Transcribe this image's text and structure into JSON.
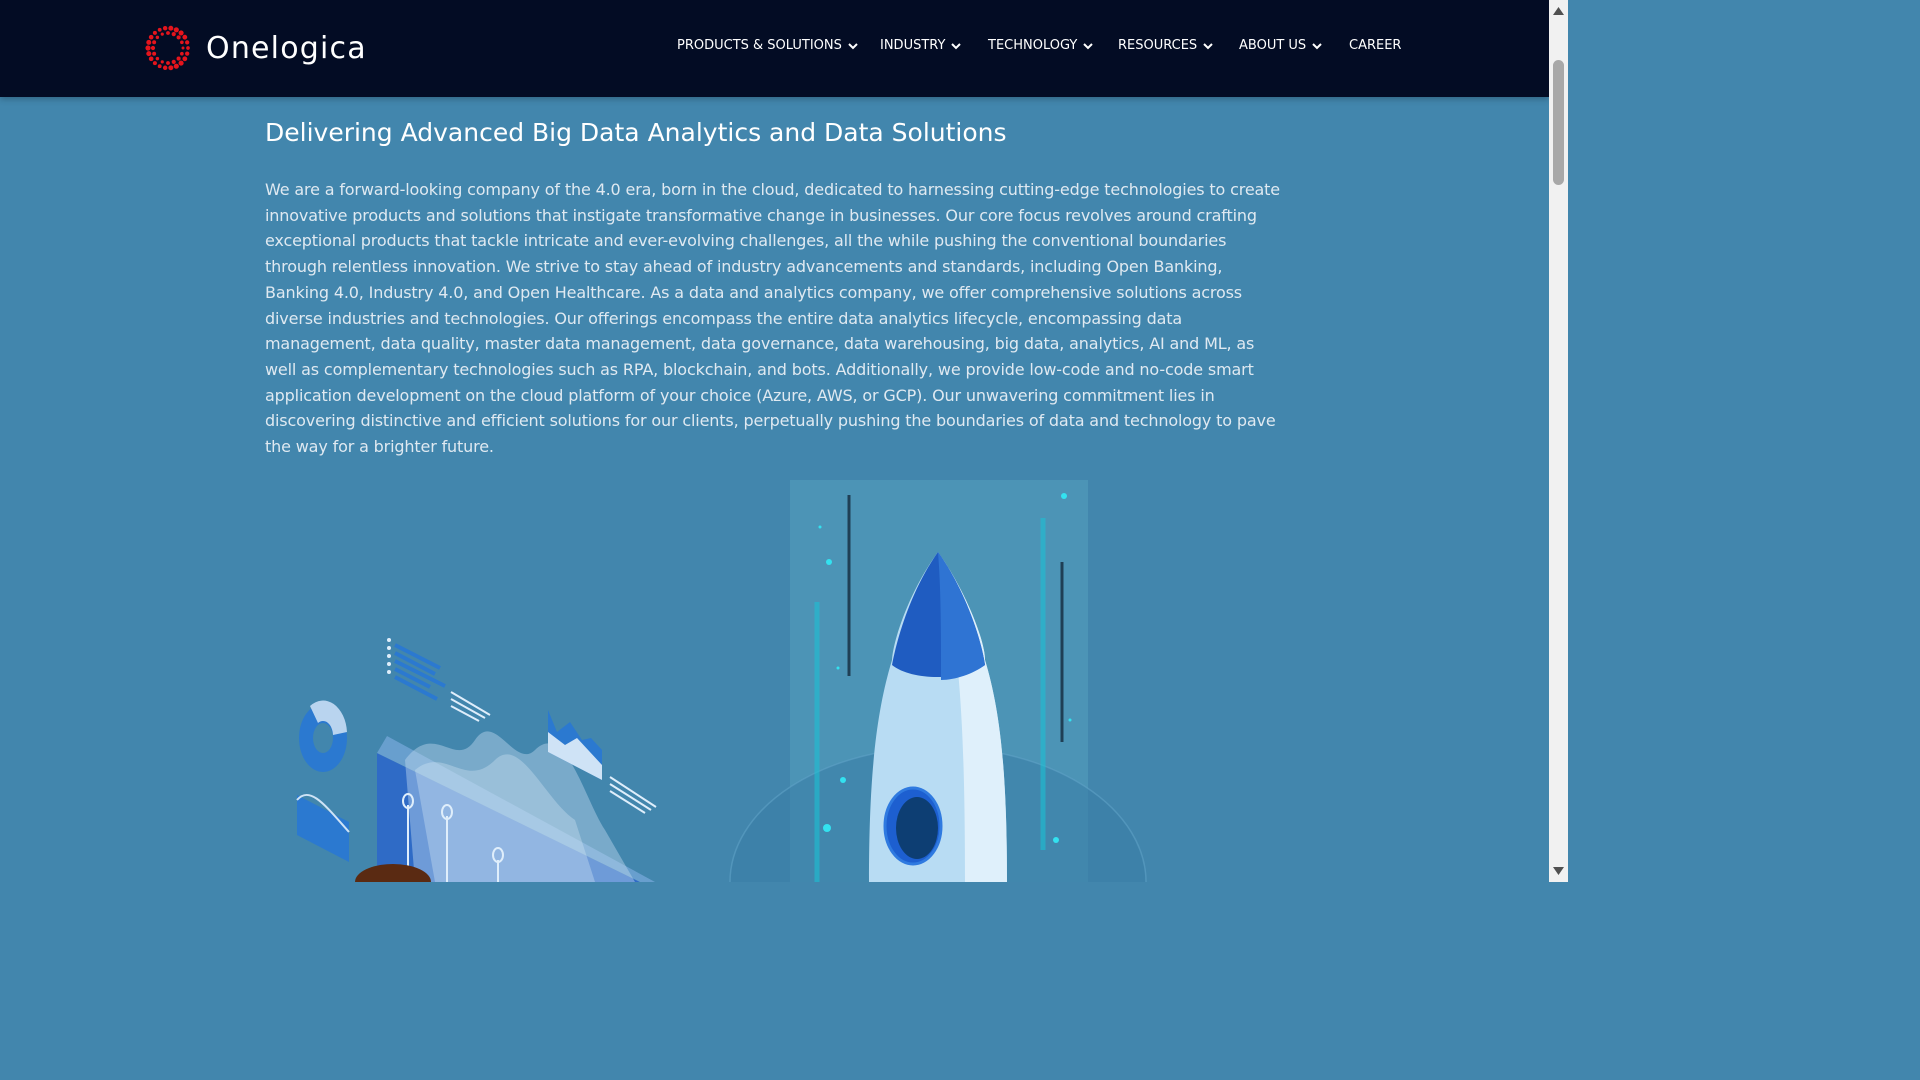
{
  "brand": {
    "name": "Onelogica",
    "logo_icon": "red-dotted-ring-logo",
    "accent": "#e5141c"
  },
  "nav": {
    "items": [
      {
        "label": "PRODUCTS & SOLUTIONS",
        "has_dropdown": true
      },
      {
        "label": "INDUSTRY",
        "has_dropdown": true
      },
      {
        "label": "TECHNOLOGY",
        "has_dropdown": true
      },
      {
        "label": "RESOURCES",
        "has_dropdown": true
      },
      {
        "label": "ABOUT US",
        "has_dropdown": true
      },
      {
        "label": "CAREER",
        "has_dropdown": false
      }
    ],
    "dropdown_icon": "chevron-down-icon"
  },
  "main": {
    "heading": "Delivering Advanced Big Data Analytics and Data Solutions",
    "paragraph": "We are a forward-looking company of the 4.0 era, born in the cloud, dedicated to harnessing cutting-edge technologies to create innovative products and solutions that instigate transformative change in businesses. Our core focus revolves around crafting exceptional products that tackle intricate and ever-evolving challenges, all the while pushing the conventional boundaries through relentless innovation. We strive to stay ahead of industry advancements and standards, including Open Banking, Banking 4.0, Industry 4.0, and Open Healthcare. As a data and analytics company, we offer comprehensive solutions across diverse industries and technologies. Our offerings encompass the entire data analytics lifecycle, encompassing data management, data quality, master data management, data governance, data warehousing, big data, analytics, AI and ML, as well as complementary technologies such as RPA, blockchain, and bots. Additionally, we provide low-code and no-code smart application development on the cloud platform of your choice (Azure, AWS, or GCP). Our unwavering commitment lies in discovering distinctive and efficient solutions for our clients, perpetually pushing the boundaries of data and technology to pave the way for a brighter future."
  },
  "colors": {
    "navbar_bg": "#030c24",
    "page_bg": "#4286ad",
    "text": "#ffffff"
  }
}
